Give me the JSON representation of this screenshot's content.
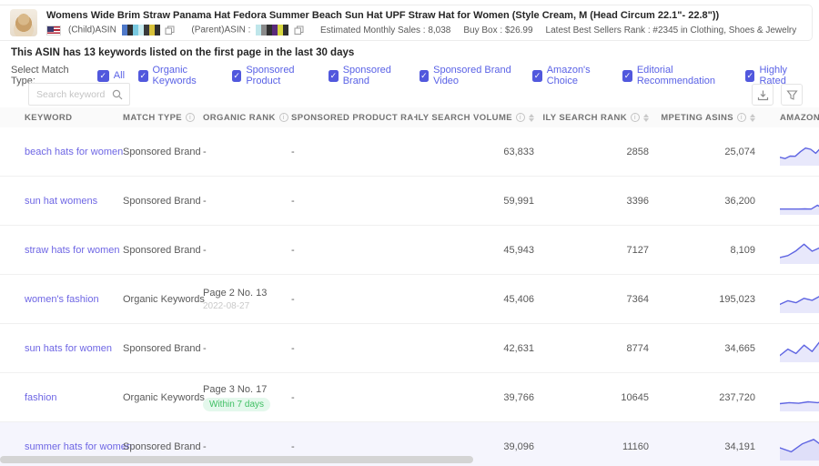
{
  "product": {
    "title": "Womens Wide Brim Straw Panama Hat Fedora Summer Beach Sun Hat UPF Straw Hat for Women (Style Cream, M (Head Circum 22.1\"- 22.8\"))",
    "child_asin_label": "(Child)ASIN",
    "parent_asin_label": "(Parent)ASIN :",
    "estimated_monthly_sales": "Estimated Monthly Sales : 8,038",
    "buy_box": "Buy Box : $26.99",
    "best_sellers_rank": "Latest Best Sellers Rank : #2345 in Clothing, Shoes & Jewelry",
    "child_asin_mosaic": [
      "#4f79c9",
      "#2f2f2f",
      "#79c9e0",
      "#c9ecf0",
      "#3a3a3a",
      "#d8c23a",
      "#2f2f2f"
    ],
    "parent_asin_mosaic": [
      "#bfe6ea",
      "#8a8a8a",
      "#2f2f2f",
      "#5a2a7a",
      "#d8d840",
      "#2f2f2f"
    ]
  },
  "summary": "This ASIN has 13 keywords listed on the first page in the last 30 days",
  "filters": {
    "label": "Select Match Type:",
    "options": [
      {
        "label": "All",
        "checked": true
      },
      {
        "label": "Organic Keywords",
        "checked": true
      },
      {
        "label": "Sponsored Product",
        "checked": true
      },
      {
        "label": "Sponsored Brand",
        "checked": true
      },
      {
        "label": "Sponsored Brand Video",
        "checked": true
      },
      {
        "label": "Amazon's Choice",
        "checked": true
      },
      {
        "label": "Editorial Recommendation",
        "checked": true
      },
      {
        "label": "Highly Rated",
        "checked": true
      }
    ]
  },
  "search": {
    "placeholder": "Search keyword"
  },
  "colors": {
    "accent": "#5158dd",
    "link": "#6e66e4",
    "spark": "#5e64e2",
    "badge_green": "#3fbf63"
  },
  "table": {
    "columns": [
      {
        "label": "KEYWORD",
        "info": false,
        "sort": false
      },
      {
        "label": "MATCH TYPE",
        "info": true,
        "sort": false
      },
      {
        "label": "ORGANIC RANK",
        "info": true,
        "sort": true
      },
      {
        "label": "SPONSORED PRODUCT RANK",
        "info": true,
        "sort": true
      },
      {
        "label": "MONTHLY SEARCH VOLUME",
        "info": true,
        "sort": true
      },
      {
        "label": "MONTHLY SEARCH RANK",
        "info": true,
        "sort": true
      },
      {
        "label": "COMPETING ASINS",
        "info": true,
        "sort": true
      },
      {
        "label": "AMAZON",
        "info": false,
        "sort": false
      }
    ],
    "rows": [
      {
        "keyword": "beach hats for women",
        "match_type": "Sponsored Brand",
        "organic_rank": "-",
        "organic_rank_sub": "",
        "organic_rank_sub_type": "",
        "sponsored_product_rank": "-",
        "monthly_search_volume": "63,833",
        "monthly_search_rank": "2858",
        "competing_asins": "25,074",
        "highlight": false,
        "trend": [
          0.28,
          0.22,
          0.34,
          0.33,
          0.56,
          0.74,
          0.68,
          0.48,
          0.76,
          0.58,
          0.92,
          0.78
        ]
      },
      {
        "keyword": "sun hat womens",
        "match_type": "Sponsored Brand",
        "organic_rank": "-",
        "organic_rank_sub": "",
        "organic_rank_sub_type": "",
        "sponsored_product_rank": "-",
        "monthly_search_volume": "59,991",
        "monthly_search_rank": "3396",
        "competing_asins": "36,200",
        "highlight": false,
        "trend": [
          0.15,
          0.15,
          0.15,
          0.15,
          0.16,
          0.15,
          0.34,
          0.15,
          0.15,
          0.15
        ]
      },
      {
        "keyword": "straw hats for women",
        "match_type": "Sponsored Brand",
        "organic_rank": "-",
        "organic_rank_sub": "",
        "organic_rank_sub_type": "",
        "sponsored_product_rank": "-",
        "monthly_search_volume": "45,943",
        "monthly_search_rank": "7127",
        "competing_asins": "8,109",
        "highlight": false,
        "trend": [
          0.18,
          0.28,
          0.52,
          0.85,
          0.5,
          0.68,
          0.38,
          0.3
        ]
      },
      {
        "keyword": "women's fashion",
        "match_type": "Organic Keywords",
        "organic_rank": "Page 2 No. 13",
        "organic_rank_sub": "2022-08-27",
        "organic_rank_sub_type": "date",
        "sponsored_product_rank": "-",
        "monthly_search_volume": "45,406",
        "monthly_search_rank": "7364",
        "competing_asins": "195,023",
        "highlight": false,
        "trend": [
          0.3,
          0.48,
          0.38,
          0.6,
          0.5,
          0.72,
          0.6,
          0.82
        ]
      },
      {
        "keyword": "sun hats for women",
        "match_type": "Sponsored Brand",
        "organic_rank": "-",
        "organic_rank_sub": "",
        "organic_rank_sub_type": "",
        "sponsored_product_rank": "-",
        "monthly_search_volume": "42,631",
        "monthly_search_rank": "8774",
        "competing_asins": "34,665",
        "highlight": false,
        "trend": [
          0.2,
          0.52,
          0.3,
          0.72,
          0.4,
          0.92,
          0.82,
          0.6
        ]
      },
      {
        "keyword": "fashion",
        "match_type": "Organic Keywords",
        "organic_rank": "Page 3 No. 17",
        "organic_rank_sub": "Within 7 days",
        "organic_rank_sub_type": "badge",
        "sponsored_product_rank": "-",
        "monthly_search_volume": "39,766",
        "monthly_search_rank": "10645",
        "competing_asins": "237,720",
        "highlight": false,
        "trend": [
          0.25,
          0.3,
          0.27,
          0.34,
          0.3,
          0.38,
          0.95
        ]
      },
      {
        "keyword": "summer hats for women",
        "match_type": "Sponsored Brand",
        "organic_rank": "-",
        "organic_rank_sub": "",
        "organic_rank_sub_type": "",
        "sponsored_product_rank": "-",
        "monthly_search_volume": "39,096",
        "monthly_search_rank": "11160",
        "competing_asins": "34,191",
        "highlight": true,
        "trend": [
          0.5,
          0.3,
          0.7,
          0.92,
          0.5,
          0.64
        ]
      }
    ]
  }
}
